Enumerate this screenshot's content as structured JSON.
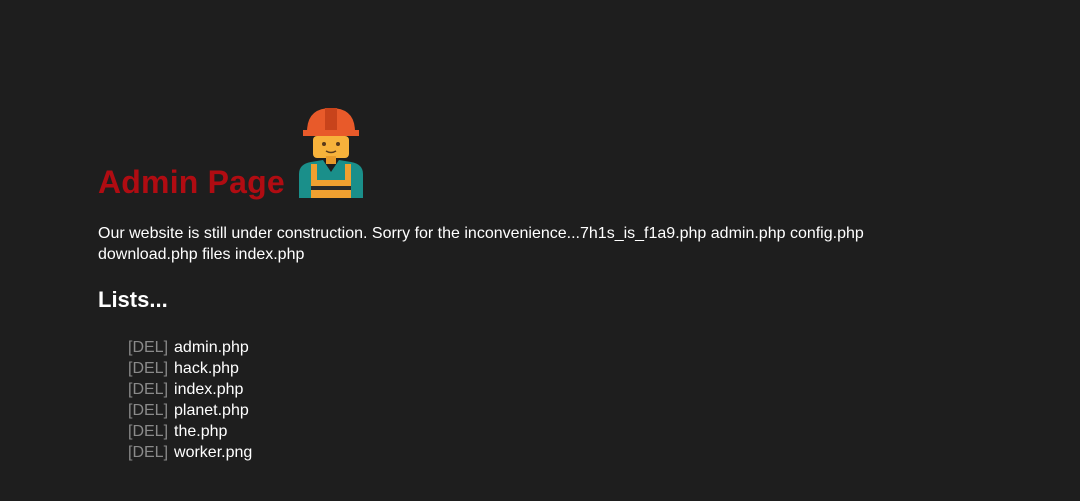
{
  "title": "Admin Page",
  "worker_icon": "construction-worker-icon",
  "description": "Our website is still under construction. Sorry for the inconvenience...7h1s_is_f1a9.php admin.php config.php download.php files index.php",
  "lists_heading": "Lists...",
  "del_label": "[DEL]",
  "files": [
    "admin.php",
    "hack.php",
    "index.php",
    "planet.php",
    "the.php",
    "worker.png"
  ],
  "colors": {
    "background": "#1e1e1e",
    "title": "#b00c12",
    "text": "#ffffff",
    "del": "#8a8a8a",
    "helmet": "#e85a2a",
    "vest": "#1a8f8a"
  }
}
